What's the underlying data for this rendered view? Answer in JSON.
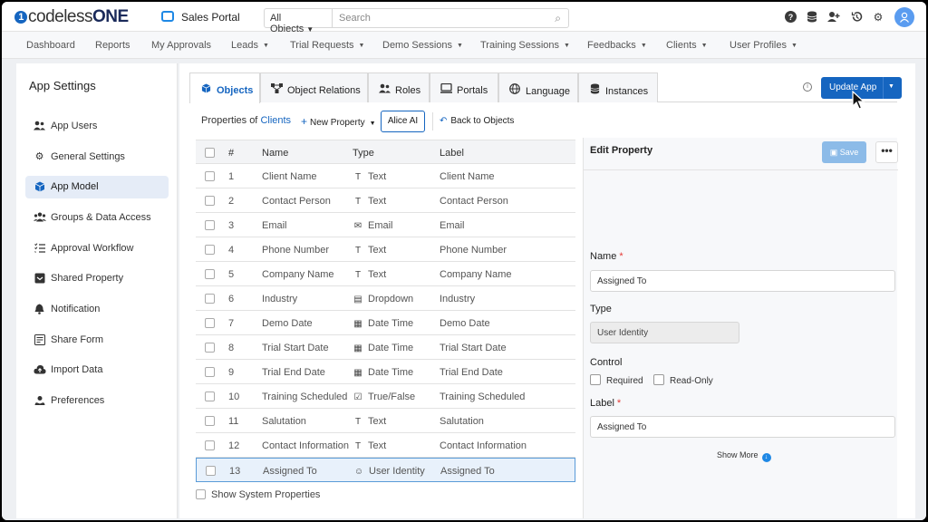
{
  "brand": {
    "logo_prefix": "codeless",
    "logo_suffix": "ONE",
    "logo_mark": "1"
  },
  "app": {
    "title": "Sales Portal"
  },
  "search": {
    "object_filter": "All Objects",
    "placeholder": "Search"
  },
  "top_icons": [
    "help-icon",
    "database-icon",
    "add-user-icon",
    "history-icon",
    "settings-icon",
    "user-avatar-icon"
  ],
  "nav": {
    "items": [
      {
        "label": "Dashboard",
        "dropdown": false
      },
      {
        "label": "Reports",
        "dropdown": false
      },
      {
        "label": "My Approvals",
        "dropdown": false
      },
      {
        "label": "Leads",
        "dropdown": true
      },
      {
        "label": "Trial Requests",
        "dropdown": true
      },
      {
        "label": "Demo Sessions",
        "dropdown": true
      },
      {
        "label": "Training Sessions",
        "dropdown": true
      },
      {
        "label": "Feedbacks",
        "dropdown": true
      },
      {
        "label": "Clients",
        "dropdown": true
      },
      {
        "label": "User Profiles",
        "dropdown": true
      }
    ]
  },
  "sidebar": {
    "title": "App Settings",
    "items": [
      {
        "label": "App Users",
        "icon": "users-icon"
      },
      {
        "label": "General Settings",
        "icon": "gear-icon"
      },
      {
        "label": "App Model",
        "icon": "cube-icon",
        "active": true
      },
      {
        "label": "Groups & Data Access",
        "icon": "group-icon"
      },
      {
        "label": "Approval Workflow",
        "icon": "checklist-icon"
      },
      {
        "label": "Shared Property",
        "icon": "shared-icon"
      },
      {
        "label": "Notification",
        "icon": "bell-icon"
      },
      {
        "label": "Share Form",
        "icon": "form-icon"
      },
      {
        "label": "Import Data",
        "icon": "cloud-upload-icon"
      },
      {
        "label": "Preferences",
        "icon": "preferences-icon"
      }
    ]
  },
  "tabs": [
    {
      "label": "Objects",
      "icon": "cube-icon",
      "active": true
    },
    {
      "label": "Object Relations",
      "icon": "relations-icon"
    },
    {
      "label": "Roles",
      "icon": "roles-icon"
    },
    {
      "label": "Portals",
      "icon": "portal-icon"
    },
    {
      "label": "Language",
      "icon": "globe-icon"
    },
    {
      "label": "Instances",
      "icon": "database-icon"
    }
  ],
  "toolbar": {
    "update_label": "Update App",
    "properties_of": "Properties of",
    "class_name": "Clients",
    "new_property": "New Property",
    "alice": "Alice AI",
    "back": "Back to Objects"
  },
  "table": {
    "headers": {
      "num": "#",
      "name": "Name",
      "type": "Type",
      "label": "Label"
    },
    "rows": [
      {
        "num": "1",
        "name": "Client Name",
        "type": "Text",
        "type_icon": "text-icon",
        "label": "Client Name"
      },
      {
        "num": "2",
        "name": "Contact Person",
        "type": "Text",
        "type_icon": "text-icon",
        "label": "Contact Person"
      },
      {
        "num": "3",
        "name": "Email",
        "type": "Email",
        "type_icon": "email-icon",
        "label": "Email"
      },
      {
        "num": "4",
        "name": "Phone Number",
        "type": "Text",
        "type_icon": "text-icon",
        "label": "Phone Number"
      },
      {
        "num": "5",
        "name": "Company Name",
        "type": "Text",
        "type_icon": "text-icon",
        "label": "Company Name"
      },
      {
        "num": "6",
        "name": "Industry",
        "type": "Dropdown",
        "type_icon": "dropdown-icon",
        "label": "Industry"
      },
      {
        "num": "7",
        "name": "Demo Date",
        "type": "Date Time",
        "type_icon": "calendar-icon",
        "label": "Demo Date"
      },
      {
        "num": "8",
        "name": "Trial Start Date",
        "type": "Date Time",
        "type_icon": "calendar-icon",
        "label": "Trial Start Date"
      },
      {
        "num": "9",
        "name": "Trial End Date",
        "type": "Date Time",
        "type_icon": "calendar-icon",
        "label": "Trial End Date"
      },
      {
        "num": "10",
        "name": "Training Scheduled",
        "type": "True/False",
        "type_icon": "checkbox-icon",
        "label": "Training Scheduled"
      },
      {
        "num": "11",
        "name": "Salutation",
        "type": "Text",
        "type_icon": "text-icon",
        "label": "Salutation"
      },
      {
        "num": "12",
        "name": "Contact Information",
        "type": "Text",
        "type_icon": "text-icon",
        "label": "Contact Information"
      },
      {
        "num": "13",
        "name": "Assigned To",
        "type": "User Identity",
        "type_icon": "user-icon",
        "label": "Assigned To",
        "selected": true
      }
    ],
    "show_system": "Show System Properties"
  },
  "edit": {
    "title": "Edit Property",
    "save": "Save",
    "more": "•••",
    "name_label": "Name",
    "name_value": "Assigned To",
    "type_label": "Type",
    "type_value": "User Identity",
    "control_label": "Control",
    "required_label": "Required",
    "readonly_label": "Read-Only",
    "label_label": "Label",
    "label_value": "Assigned To",
    "show_more": "Show More"
  },
  "colors": {
    "accent": "#1565c0",
    "active_bg": "#e5ecf7",
    "save_disabled": "#8cbbe8"
  }
}
